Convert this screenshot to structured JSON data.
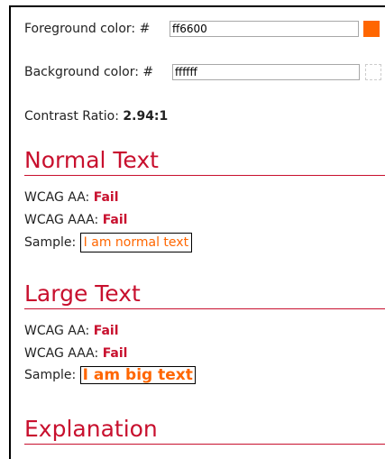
{
  "colors": {
    "foreground": "#ff6600",
    "background": "#ffffff",
    "accent": "#c8102e"
  },
  "foreground": {
    "label": "Foreground color:",
    "prefix": "#",
    "value": "ff6600"
  },
  "background": {
    "label": "Background color:",
    "prefix": "#",
    "value": "ffffff"
  },
  "contrast": {
    "label": "Contrast Ratio:",
    "value": "2.94:1"
  },
  "normal_text": {
    "heading": "Normal Text",
    "aa_label": "WCAG AA:",
    "aa_result": "Fail",
    "aaa_label": "WCAG AAA:",
    "aaa_result": "Fail",
    "sample_label": "Sample:",
    "sample_text": "I am normal text"
  },
  "large_text": {
    "heading": "Large Text",
    "aa_label": "WCAG AA:",
    "aa_result": "Fail",
    "aaa_label": "WCAG AAA:",
    "aaa_result": "Fail",
    "sample_label": "Sample:",
    "sample_text": "I am big text"
  },
  "explanation": {
    "heading": "Explanation"
  }
}
